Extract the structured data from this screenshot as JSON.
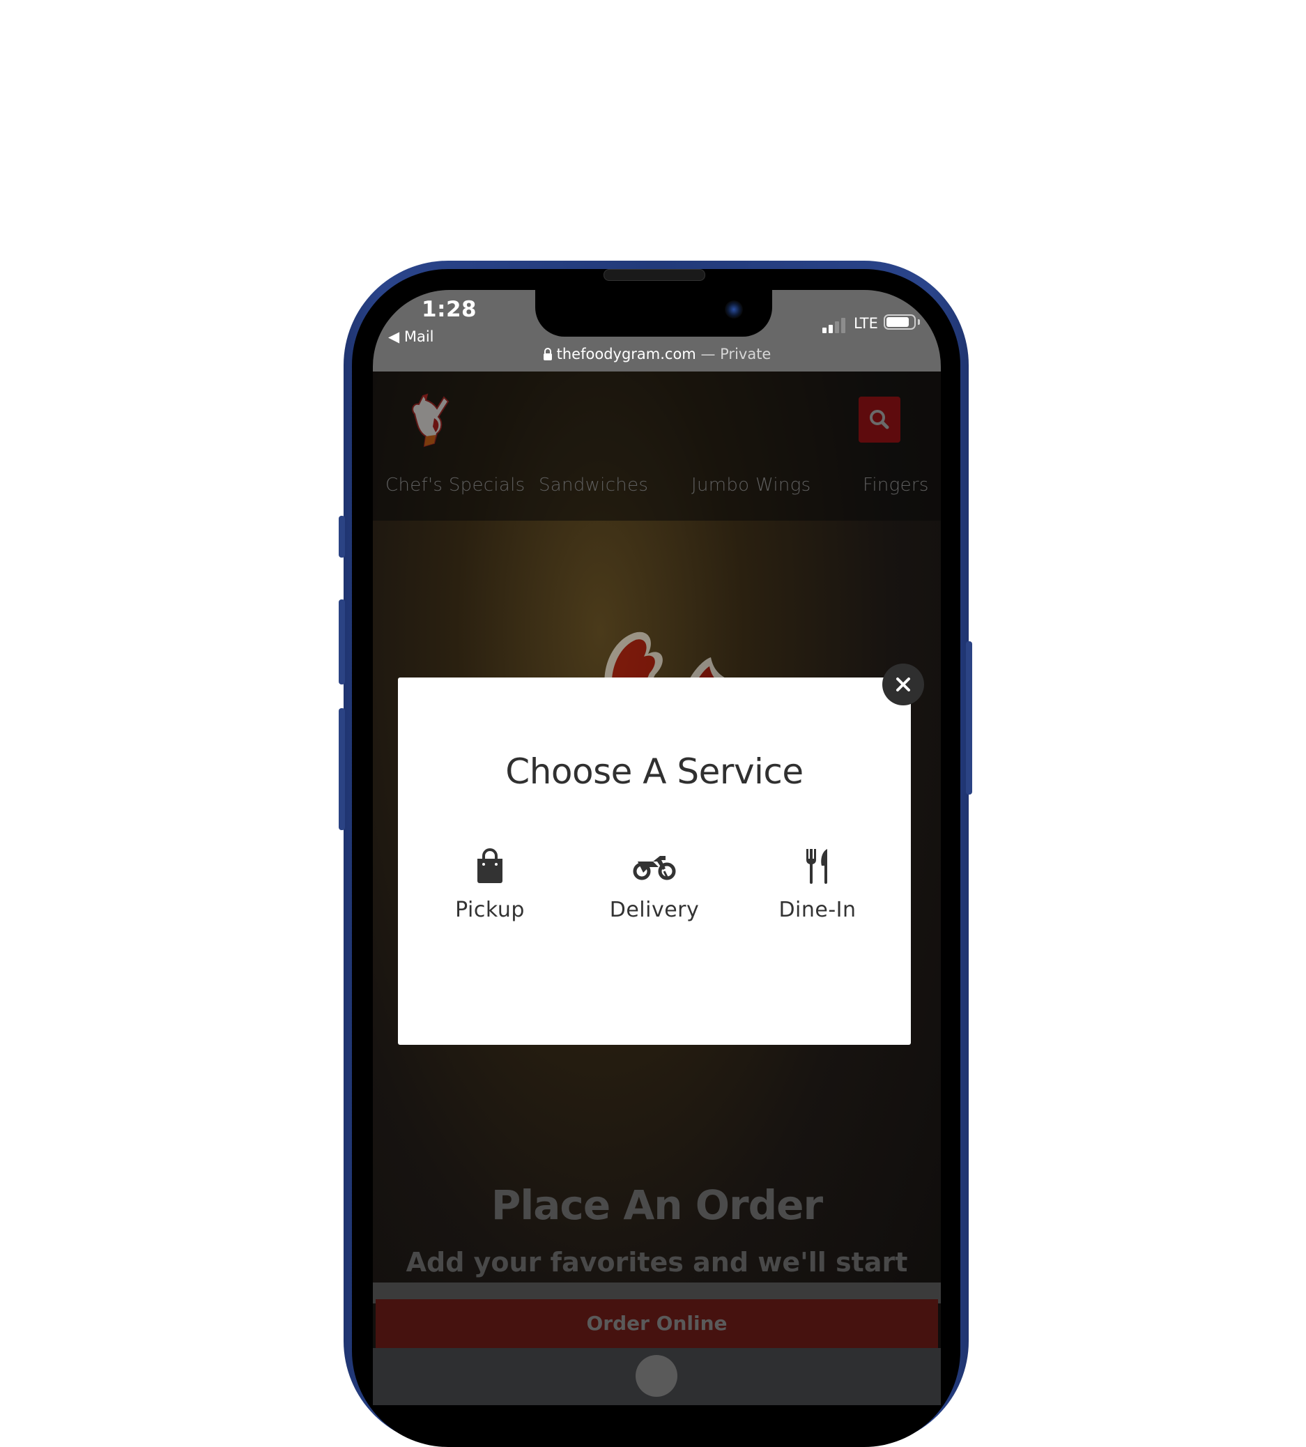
{
  "status_bar": {
    "time": "1:28",
    "back_app": "Mail",
    "network": "LTE",
    "signal_bars_filled": 2,
    "signal_bars_total": 4,
    "battery_level": 0.85
  },
  "browser": {
    "domain": "thefoodygram.com",
    "mode_separator": " — ",
    "mode": "Private"
  },
  "site": {
    "logo_alt": "rooster-mascot-logo",
    "search_icon": "search-icon",
    "nav": [
      {
        "label": "Chef's Specials"
      },
      {
        "label": "Sandwiches"
      },
      {
        "label": "Jumbo Wings"
      },
      {
        "label": "Fingers"
      }
    ],
    "hero": {
      "title": "Place An Order",
      "subtitle": "Add your favorites and we'll start them for you in seconds."
    },
    "order_button": "Order Online"
  },
  "modal": {
    "title": "Choose A Service",
    "options": [
      {
        "label": "Pickup",
        "icon": "shopping-bag-icon"
      },
      {
        "label": "Delivery",
        "icon": "motorcycle-icon"
      },
      {
        "label": "Dine-In",
        "icon": "utensils-icon"
      }
    ],
    "close_icon": "close-icon"
  },
  "colors": {
    "phone_frame": "#223a7a",
    "brand_red": "#5e0b0d",
    "order_button_bg": "#46120f",
    "modal_bg": "#ffffff",
    "status_bar_bg": "#686868"
  }
}
